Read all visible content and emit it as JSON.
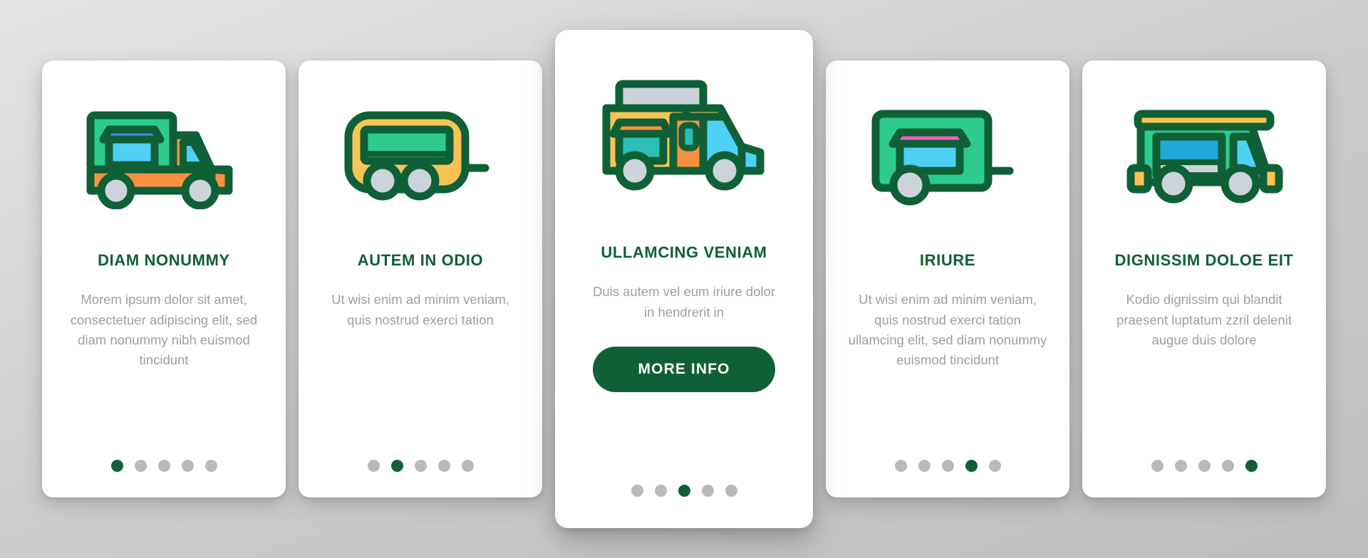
{
  "palette": {
    "dark_green": "#0f6036",
    "mint": "#2ecb8f",
    "yellow": "#f9c453",
    "orange": "#f79140",
    "cyan": "#4fd0f5",
    "blue": "#3d8ae8",
    "teal": "#2bbfb5",
    "gray_wheel": "#ccd3da",
    "pink": "#ef5fc0",
    "body_text": "#9aa396",
    "dot_inactive": "#b9b9b9",
    "card_bg": "#ffffff",
    "background_from": "#e4e4e4",
    "background_to": "#bdbdbd"
  },
  "cards": [
    {
      "icon_name": "pickup-truck-with-box-icon",
      "title": "DIAM NONUMMY",
      "body": "Morem ipsum dolor sit amet, consectetuer adipiscing elit, sed diam nonummy nibh euismod tincidunt",
      "dots": {
        "count": 5,
        "active_index": 0
      },
      "featured": false,
      "button": null
    },
    {
      "icon_name": "yellow-caravan-trailer-icon",
      "title": "AUTEM IN ODIO",
      "body": "Ut wisi enim ad minim veniam, quis nostrud exerci tation",
      "dots": {
        "count": 5,
        "active_index": 1
      },
      "featured": false,
      "button": null
    },
    {
      "icon_name": "food-truck-icon",
      "title": "ULLAMCING VENIAM",
      "body": "Duis autem vel eum iriure dolor in hendrerit in",
      "dots": {
        "count": 5,
        "active_index": 2
      },
      "featured": true,
      "button": {
        "label": "MORE INFO"
      }
    },
    {
      "icon_name": "green-trailer-with-awning-icon",
      "title": "IRIURE",
      "body": "Ut wisi enim ad minim veniam, quis nostrud exerci tation ullamcing elit, sed diam nonummy euismod tincidunt",
      "dots": {
        "count": 5,
        "active_index": 3
      },
      "featured": false,
      "button": null
    },
    {
      "icon_name": "green-camper-van-icon",
      "title": "DIGNISSIM DOLOE EIT",
      "body": "Kodio dignissim qui blandit praesent luptatum zzril delenit augue duis dolore",
      "dots": {
        "count": 5,
        "active_index": 4
      },
      "featured": false,
      "button": null
    }
  ]
}
